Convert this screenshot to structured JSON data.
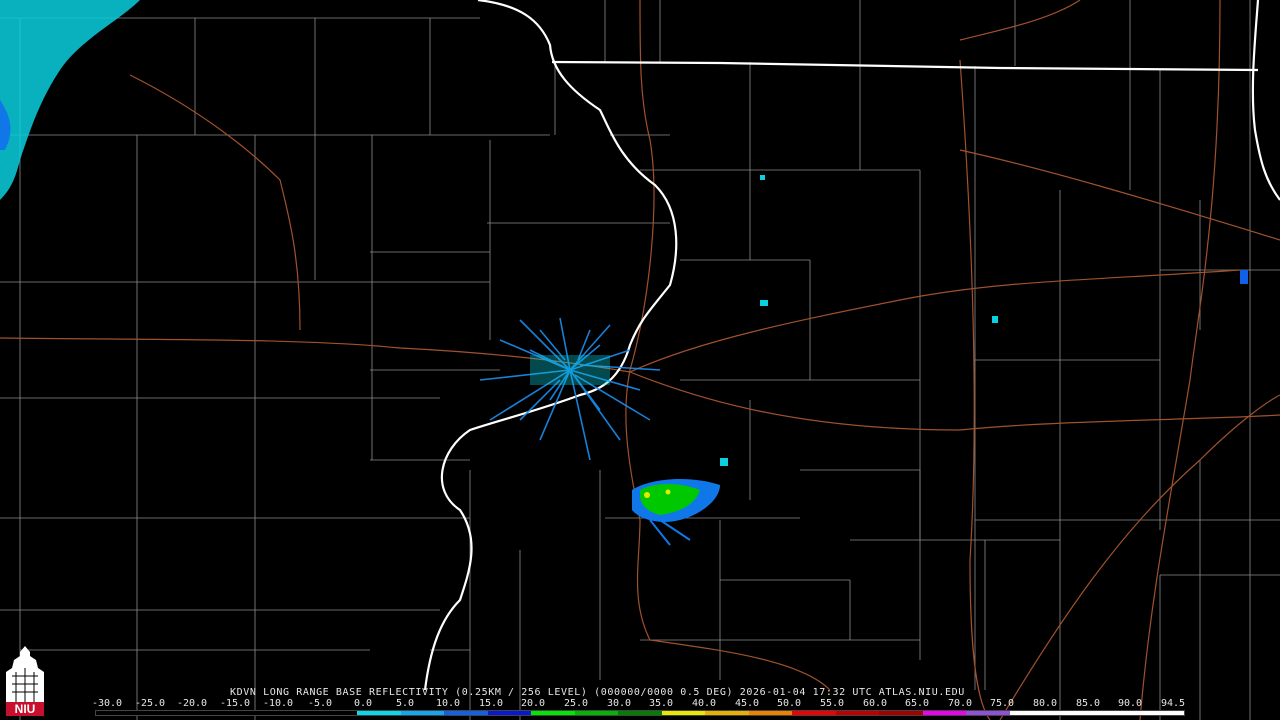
{
  "product": {
    "caption": "KDVN LONG RANGE BASE REFLECTIVITY (0.25KM / 256 LEVEL) (000000/0000 0.5 DEG) 2026-01-04 17:32 UTC  ATLAS.NIU.EDU",
    "station": "KDVN",
    "timestamp": "2026-01-04 17:32 UTC",
    "source": "ATLAS.NIU.EDU"
  },
  "logo": {
    "text": "NIU",
    "accent_color": "#c8102e"
  },
  "colorbar": {
    "ticks": [
      "-30.0",
      "-25.0",
      "-20.0",
      "-15.0",
      "-10.0",
      "-5.0",
      "0.0",
      "5.0",
      "10.0",
      "15.0",
      "20.0",
      "25.0",
      "30.0",
      "35.0",
      "40.0",
      "45.0",
      "50.0",
      "55.0",
      "60.0",
      "65.0",
      "70.0",
      "75.0",
      "80.0",
      "85.0",
      "90.0",
      "94.5"
    ],
    "colors": [
      "#000000",
      "#000000",
      "#000000",
      "#000000",
      "#000000",
      "#000000",
      "#08d8e8",
      "#10a8f0",
      "#1060e8",
      "#0818d0",
      "#00e800",
      "#00b800",
      "#008000",
      "#e8e800",
      "#e8b000",
      "#f08000",
      "#f00000",
      "#c00000",
      "#a00000",
      "#f000f0",
      "#9050d8",
      "#ffffff",
      "#ffffff",
      "#ffffff",
      "#ffffff"
    ]
  },
  "map_colors": {
    "state_border": "#ffffff",
    "county_line": "#8c8c8c",
    "road": "#a0522d",
    "light_echo": "#0ad0e0",
    "mid_echo": "#1077e8",
    "strong_echo": "#00d000"
  }
}
